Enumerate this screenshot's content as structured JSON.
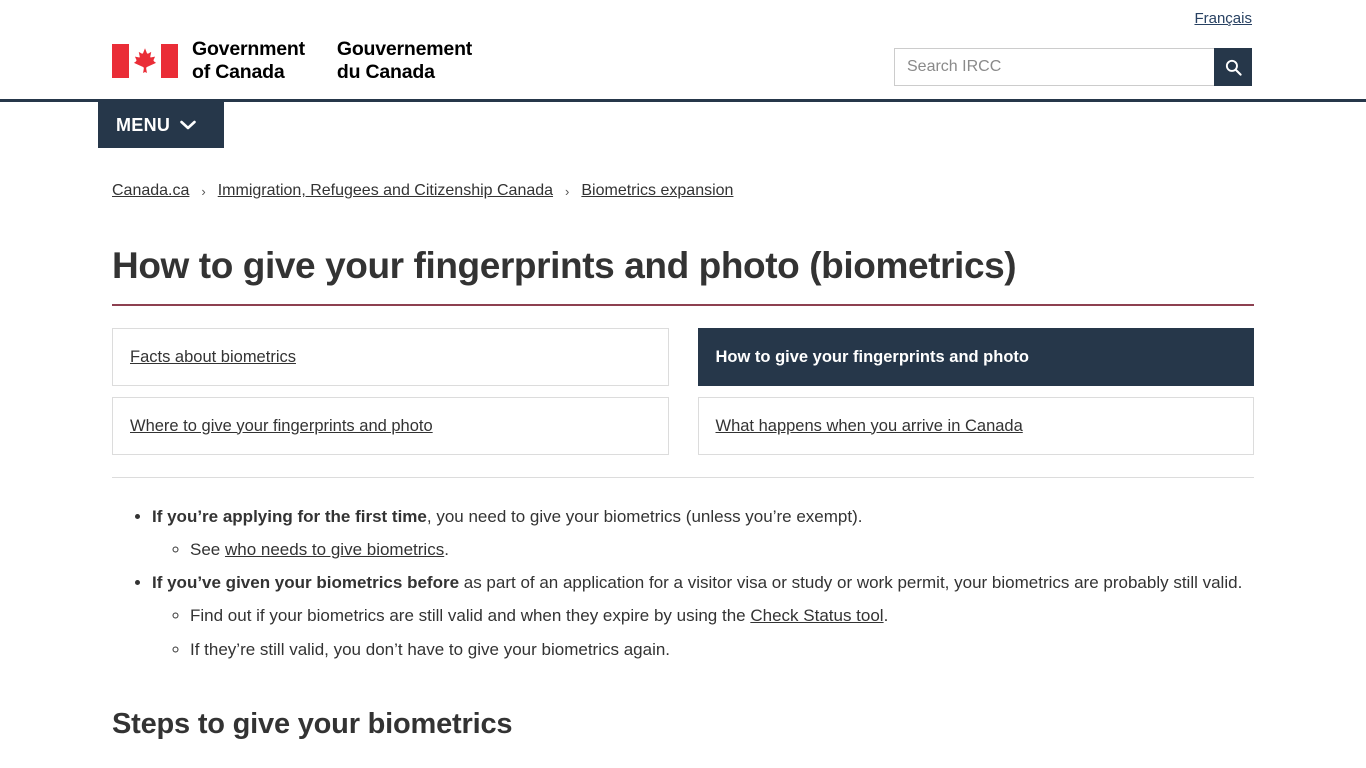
{
  "header": {
    "lang_link": "Français",
    "wordmark_en_line1": "Government",
    "wordmark_en_line2": "of Canada",
    "wordmark_fr_line1": "Gouvernement",
    "wordmark_fr_line2": "du Canada",
    "search_placeholder": "Search IRCC",
    "search_value": "",
    "search_icon": "search-icon",
    "flag_icon": "canada-flag-icon",
    "menu_label": "MENU",
    "menu_icon": "chevron-down-icon"
  },
  "breadcrumb": {
    "separator": "›",
    "items": [
      {
        "label": "Canada.ca"
      },
      {
        "label": "Immigration, Refugees and Citizenship Canada"
      },
      {
        "label": "Biometrics expansion"
      }
    ]
  },
  "main": {
    "page_title": "How to give your fingerprints and photo (biometrics)",
    "tabs": [
      {
        "label": "Facts about biometrics",
        "active": false
      },
      {
        "label": "How to give your fingerprints and photo",
        "active": true
      },
      {
        "label": "Where to give your fingerprints and photo",
        "active": false
      },
      {
        "label": "What happens when you arrive in Canada",
        "active": false
      }
    ],
    "bullets": [
      {
        "bold": "If you’re applying for the first time",
        "rest": ", you need to give your biometrics (unless you’re exempt).",
        "sub": [
          {
            "before": "See ",
            "link": "who needs to give biometrics",
            "after": "."
          }
        ]
      },
      {
        "bold": "If you’ve given your biometrics before",
        "rest": " as part of an application for a visitor visa or study or work permit, your biometrics are probably still valid.",
        "sub": [
          {
            "before": "Find out if your biometrics are still valid and when they expire by using the ",
            "link": "Check Status tool",
            "after": "."
          },
          {
            "before": "If they’re still valid, you don’t have to give your biometrics again.",
            "link": "",
            "after": ""
          }
        ]
      }
    ],
    "section_heading": "Steps to give your biometrics"
  },
  "colors": {
    "navy": "#26374a",
    "flag_red": "#ea2d37",
    "title_underline": "#8d4050",
    "border_gray": "#dcdcdc"
  }
}
